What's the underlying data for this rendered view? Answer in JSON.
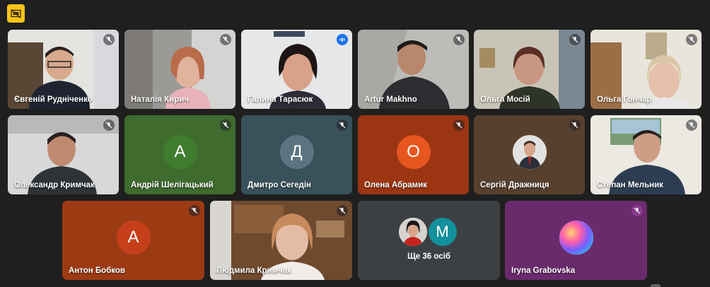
{
  "badge": {
    "icon": "presentation-off-icon",
    "color": "#f9c41a"
  },
  "participants": [
    {
      "name": "Євгеній Рудніченко",
      "mic": "muted"
    },
    {
      "name": "Наталія Кирич",
      "mic": "muted"
    },
    {
      "name": "Галина Тарасюк",
      "mic": "speaking"
    },
    {
      "name": "Artur Makhno",
      "mic": "muted"
    },
    {
      "name": "Ольга Мосій",
      "mic": "muted"
    },
    {
      "name": "Ольга Гончар",
      "mic": "muted"
    },
    {
      "name": "Олександр Кримчак",
      "mic": "muted"
    },
    {
      "name": "Андрій Шелігацький",
      "initial": "А",
      "bg": "#3f6b2f",
      "avatar_color": "#3f7c2e",
      "mic": "muted"
    },
    {
      "name": "Дмитро Сегедін",
      "initial": "Д",
      "bg": "#38515a",
      "avatar_color": "#5b7580",
      "mic": "muted"
    },
    {
      "name": "Олена Абрамик",
      "initial": "О",
      "bg": "#9b3512",
      "avatar_color": "#e8561f",
      "mic": "muted"
    },
    {
      "name": "Сергій Дражниця",
      "bg": "#57402e",
      "mic": "muted"
    },
    {
      "name": "Степан Мельник",
      "mic": "muted"
    },
    {
      "name": "Антон Бобков",
      "initial": "А",
      "bg": "#9c3a14",
      "avatar_color": "#c5401a",
      "mic": "muted"
    },
    {
      "name": "Людмила Кримчак",
      "mic": "muted"
    },
    {
      "name": "Iryna Grabovska",
      "bg": "#6a2b6c",
      "mic": "muted"
    }
  ],
  "more": {
    "label": "Ще 36 осіб",
    "initial": "М",
    "avatar_color": "#12909c"
  }
}
